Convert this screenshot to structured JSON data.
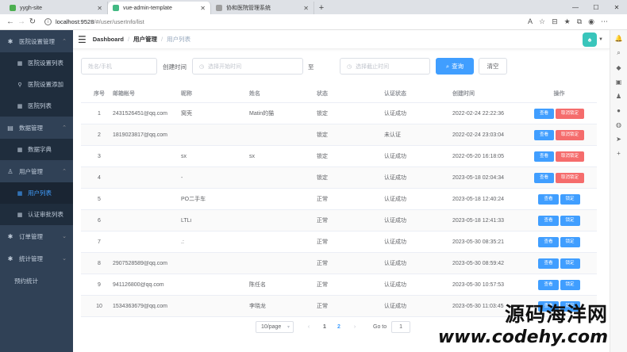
{
  "browser": {
    "tabs": [
      {
        "title": "yygh-site",
        "color": "#4caf50"
      },
      {
        "title": "vue-admin-template",
        "color": "#42b983"
      },
      {
        "title": "协和医院管理系统",
        "color": "#9e9e9e"
      }
    ],
    "url_host": "localhost:9528",
    "url_path": "/#/user/userInfo/list"
  },
  "sidebar": {
    "groups": [
      {
        "label": "医院设置管理",
        "icon": "gear-icon",
        "items": [
          {
            "label": "医院设置列表",
            "icon": "table-icon"
          },
          {
            "label": "医院设置添加",
            "icon": "tree-icon"
          },
          {
            "label": "医院列表",
            "icon": "table-icon"
          }
        ]
      },
      {
        "label": "数据管理",
        "icon": "folder-icon",
        "items": [
          {
            "label": "数据字典",
            "icon": "table-icon"
          }
        ]
      },
      {
        "label": "用户管理",
        "icon": "user-icon",
        "items": [
          {
            "label": "用户列表",
            "icon": "table-icon"
          },
          {
            "label": "认证审批列表",
            "icon": "table-icon"
          }
        ]
      },
      {
        "label": "订单管理",
        "icon": "gear-icon",
        "items": []
      },
      {
        "label": "统计管理",
        "icon": "gear-icon",
        "items": []
      }
    ],
    "plain_item": "预约统计",
    "active_item": "用户列表"
  },
  "navbar": {
    "crumbs": [
      "Dashboard",
      "用户管理",
      "用户列表"
    ]
  },
  "filters": {
    "name_placeholder": "姓名/手机",
    "create_time_label": "创建时间",
    "start_placeholder": "选择开始时间",
    "to_label": "至",
    "end_placeholder": "选择截止时间",
    "search_label": "查询",
    "clear_label": "清空"
  },
  "table": {
    "headers": [
      "序号",
      "邮箱帐号",
      "昵称",
      "姓名",
      "状态",
      "认证状态",
      "创建时间",
      "操作"
    ],
    "rows": [
      {
        "no": "1",
        "email": "2431526451@qq.com",
        "nick": "窝壳",
        "name": "Matin的猫",
        "status": "锁定",
        "auth": "认证成功",
        "time": "2022-02-24 22:22:36",
        "b1": "查看",
        "b2": "取消锁定",
        "locked": true
      },
      {
        "no": "2",
        "email": "1819023817@qq.com",
        "nick": "",
        "name": "",
        "status": "锁定",
        "auth": "未认证",
        "time": "2022-02-24 23:03:04",
        "b1": "查看",
        "b2": "取消锁定",
        "locked": true
      },
      {
        "no": "3",
        "email": "",
        "nick": "sx",
        "name": "sx",
        "status": "锁定",
        "auth": "认证成功",
        "time": "2022-05-20 16:18:05",
        "b1": "查看",
        "b2": "取消锁定",
        "locked": true
      },
      {
        "no": "4",
        "email": "",
        "nick": "-",
        "name": "",
        "status": "锁定",
        "auth": "认证成功",
        "time": "2023-05-18 02:04:34",
        "b1": "查看",
        "b2": "取消锁定",
        "locked": true
      },
      {
        "no": "5",
        "email": "",
        "nick": "PO二手车",
        "name": "",
        "status": "正常",
        "auth": "认证成功",
        "time": "2023-05-18 12:40:24",
        "b1": "查看",
        "b2": "锁定",
        "locked": false
      },
      {
        "no": "6",
        "email": "",
        "nick": "LTLi",
        "name": "",
        "status": "正常",
        "auth": "认证成功",
        "time": "2023-05-18 12:41:33",
        "b1": "查看",
        "b2": "锁定",
        "locked": false
      },
      {
        "no": "7",
        "email": "",
        "nick": ".:",
        "name": "",
        "status": "正常",
        "auth": "认证成功",
        "time": "2023-05-30 08:35:21",
        "b1": "查看",
        "b2": "锁定",
        "locked": false
      },
      {
        "no": "8",
        "email": "2907528589@qq.com",
        "nick": "",
        "name": "",
        "status": "正常",
        "auth": "认证成功",
        "time": "2023-05-30 08:59:42",
        "b1": "查看",
        "b2": "锁定",
        "locked": false
      },
      {
        "no": "9",
        "email": "941126800@qq.com",
        "nick": "",
        "name": "陈任名",
        "status": "正常",
        "auth": "认证成功",
        "time": "2023-05-30 10:57:53",
        "b1": "查看",
        "b2": "锁定",
        "locked": false
      },
      {
        "no": "10",
        "email": "1534363679@qq.com",
        "nick": "",
        "name": "李晓龙",
        "status": "正常",
        "auth": "认证成功",
        "time": "2023-05-30 11:03:45",
        "b1": "查看",
        "b2": "锁定",
        "locked": false
      }
    ]
  },
  "pagination": {
    "page_size": "10/page",
    "pages": [
      "1",
      "2"
    ],
    "current_page": "2",
    "goto_label": "Go to",
    "goto_value": "1"
  },
  "watermark": {
    "cn": "源码海洋网",
    "en": "www.codehy.com"
  }
}
